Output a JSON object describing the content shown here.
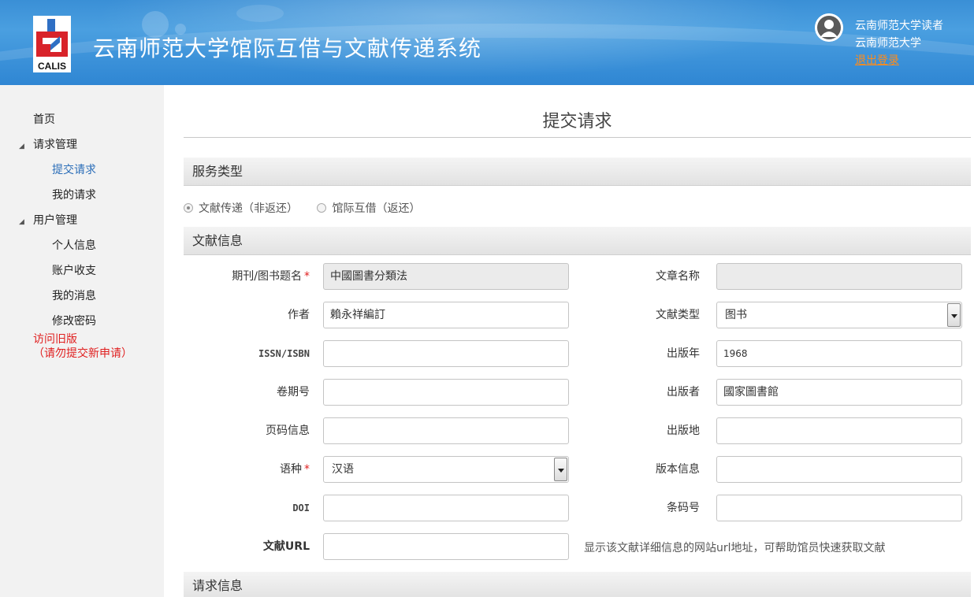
{
  "header": {
    "logo_text": "CALIS",
    "title": "云南师范大学馆际互借与文献传递系统",
    "user_name": "云南师范大学读者",
    "user_org": "云南师范大学",
    "logout_label": "退出登录"
  },
  "sidebar": {
    "items": [
      {
        "label": "首页"
      },
      {
        "label": "请求管理"
      },
      {
        "label": "提交请求"
      },
      {
        "label": "我的请求"
      },
      {
        "label": "用户管理"
      },
      {
        "label": "个人信息"
      },
      {
        "label": "账户收支"
      },
      {
        "label": "我的消息"
      },
      {
        "label": "修改密码"
      }
    ],
    "old_version_line1": "访问旧版",
    "old_version_line2": "（请勿提交新申请）"
  },
  "main": {
    "page_title": "提交请求",
    "service_section": "服务类型",
    "service_options": [
      "文献传递（非返还）",
      "馆际互借（返还）"
    ],
    "info_section": "文献信息",
    "request_section": "请求信息",
    "fields": {
      "journal_title": {
        "label": "期刊/图书题名",
        "value": "中國圖書分類法"
      },
      "article_title": {
        "label": "文章名称",
        "value": ""
      },
      "author": {
        "label": "作者",
        "value": "賴永祥編訂"
      },
      "doc_type": {
        "label": "文献类型",
        "value": "图书"
      },
      "issn": {
        "label": "ISSN/ISBN",
        "value": ""
      },
      "pub_year": {
        "label": "出版年",
        "value": "1968"
      },
      "volume": {
        "label": "卷期号",
        "value": ""
      },
      "publisher": {
        "label": "出版者",
        "value": "國家圖書館"
      },
      "pages": {
        "label": "页码信息",
        "value": ""
      },
      "pub_place": {
        "label": "出版地",
        "value": ""
      },
      "language": {
        "label": "语种",
        "value": "汉语"
      },
      "edition": {
        "label": "版本信息",
        "value": ""
      },
      "doi": {
        "label": "DOI",
        "value": ""
      },
      "barcode": {
        "label": "条码号",
        "value": ""
      },
      "url": {
        "label": "文献URL",
        "value": ""
      }
    },
    "url_hint": "显示该文献详细信息的网站url地址，可帮助馆员快速获取文献",
    "required_mark": "*"
  }
}
